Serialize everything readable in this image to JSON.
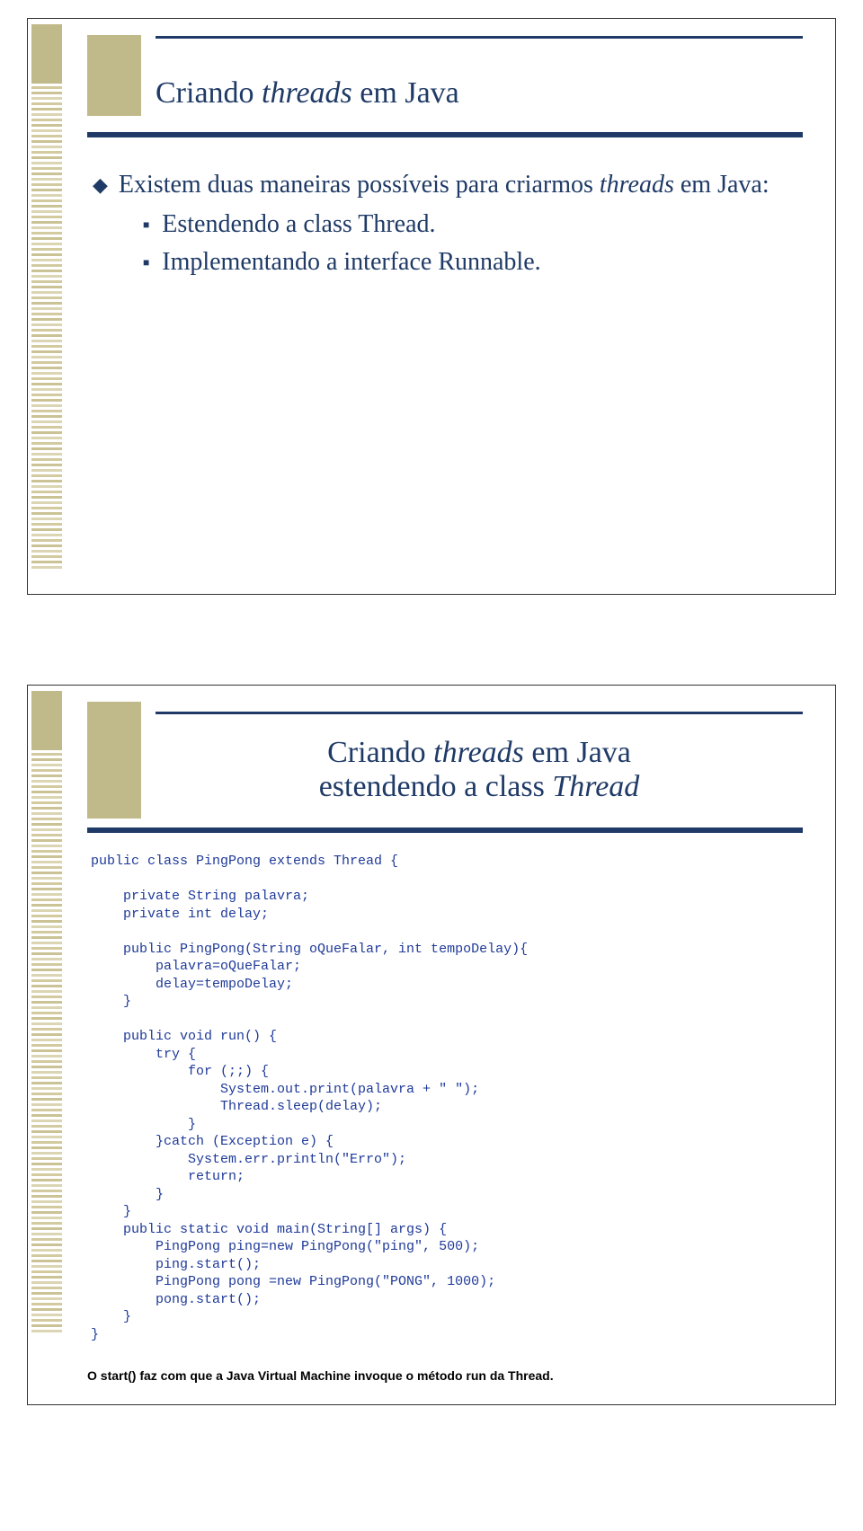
{
  "slide1": {
    "title_pre": "Criando ",
    "title_ital": "threads",
    "title_post": " em Java",
    "b1_pre": "Existem duas maneiras possíveis para criarmos ",
    "b1_ital": "threads",
    "b1_post": " em Java:",
    "s1": "Estendendo a class Thread.",
    "s2": "Implementando a interface Runnable."
  },
  "slide2": {
    "title_line1_pre": "Criando ",
    "title_line1_ital": "threads",
    "title_line1_post": " em Java",
    "title_line2_pre": "estendendo a class ",
    "title_line2_ital": "Thread",
    "code": "public class PingPong extends Thread {\n\n    private String palavra;\n    private int delay;\n\n    public PingPong(String oQueFalar, int tempoDelay){\n        palavra=oQueFalar;\n        delay=tempoDelay;\n    }\n\n    public void run() {\n        try {\n            for (;;) {\n                System.out.print(palavra + \" \");\n                Thread.sleep(delay);\n            }\n        }catch (Exception e) {\n            System.err.println(\"Erro\");\n            return;\n        }\n    }\n    public static void main(String[] args) {\n        PingPong ping=new PingPong(\"ping\", 500);\n        ping.start();\n        PingPong pong =new PingPong(\"PONG\", 1000);\n        pong.start();\n    }\n}",
    "footnote": "O start() faz com que a Java Virtual Machine invoque o método run da Thread."
  }
}
